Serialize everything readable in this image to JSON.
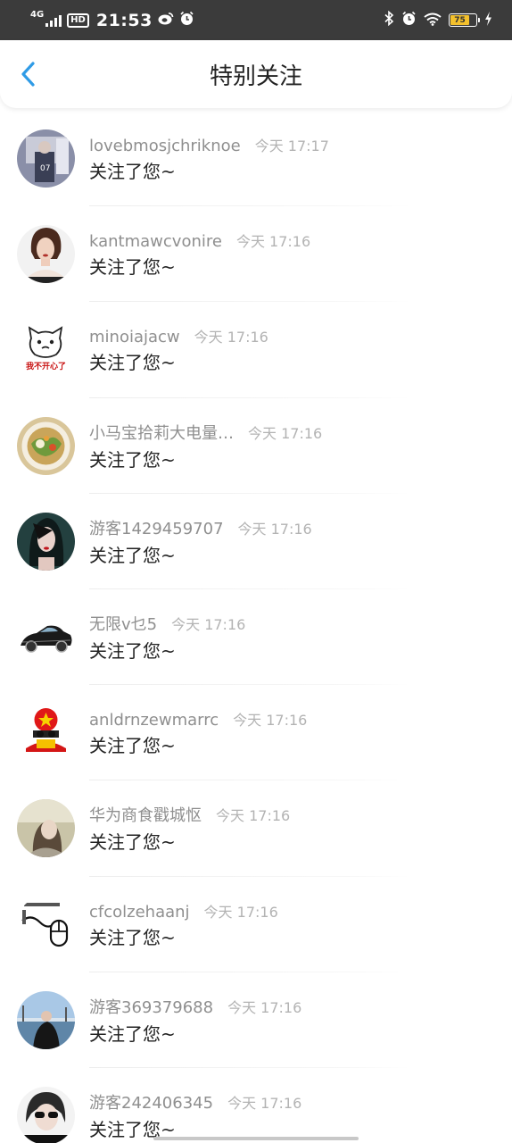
{
  "status": {
    "network": "4G",
    "hd": "HD",
    "time": "21:53",
    "weibo_icon": "weibo-icon",
    "alarm_icon": "alarm-icon",
    "battery": "75"
  },
  "nav": {
    "title": "特别关注",
    "back_icon": "chevron-left-icon"
  },
  "colors": {
    "status_bg": "#3b3b3b",
    "back_arrow": "#2f9be6",
    "battery_fill": "#f3c02c",
    "username": "#8f8f8f",
    "timestamp": "#b3b3b3"
  },
  "items": [
    {
      "user": "lovebmosjchriknoe",
      "time": "今天 17:17",
      "msg": "关注了您~"
    },
    {
      "user": "kantmawcvonire",
      "time": "今天 17:16",
      "msg": "关注了您~"
    },
    {
      "user": "minoiajacw",
      "time": "今天 17:16",
      "msg": "关注了您~",
      "avatar_caption": "我不开心了"
    },
    {
      "user": "小马宝拾莉大电量…",
      "time": "今天 17:16",
      "msg": "关注了您~"
    },
    {
      "user": "游客1429459707",
      "time": "今天 17:16",
      "msg": "关注了您~"
    },
    {
      "user": "无限v乜5",
      "time": "今天 17:16",
      "msg": "关注了您~"
    },
    {
      "user": "anldrnzewmarrc",
      "time": "今天 17:16",
      "msg": "关注了您~"
    },
    {
      "user": "华为商食戳城怄",
      "time": "今天 17:16",
      "msg": "关注了您~"
    },
    {
      "user": "cfcolzehaanj",
      "time": "今天 17:16",
      "msg": "关注了您~"
    },
    {
      "user": "游客369379688",
      "time": "今天 17:16",
      "msg": "关注了您~"
    },
    {
      "user": "游客242406345",
      "time": "今天 17:16",
      "msg": "关注了您~"
    }
  ]
}
